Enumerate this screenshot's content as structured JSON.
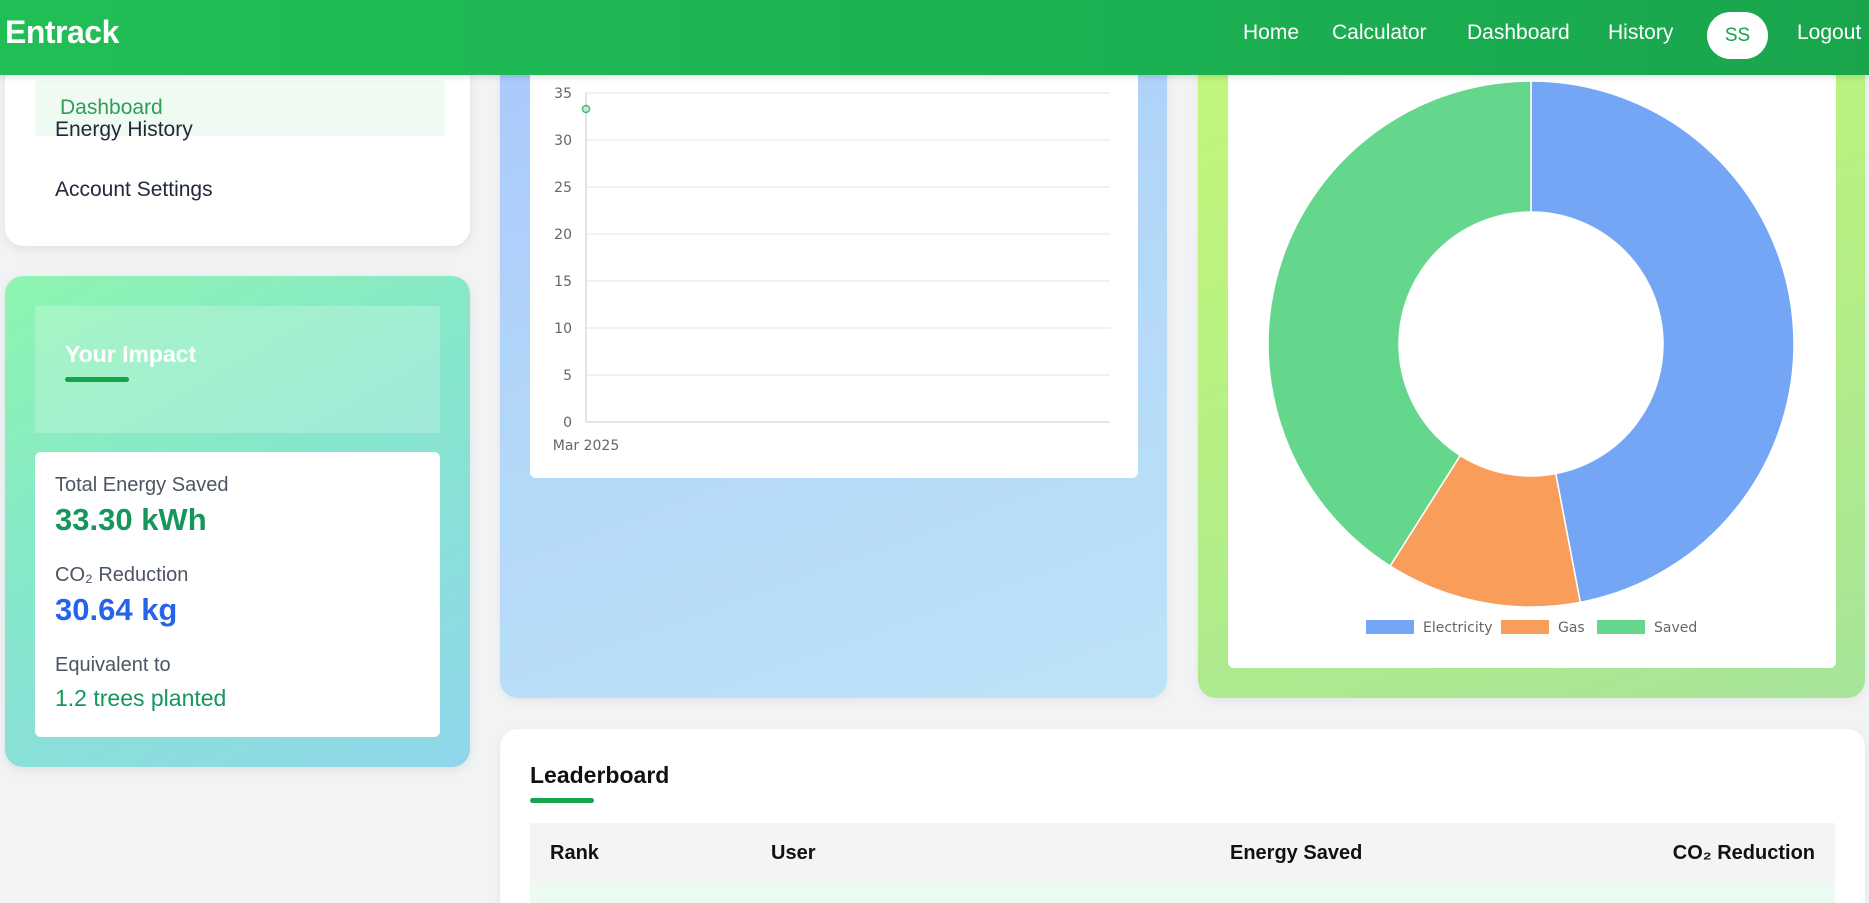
{
  "navbar": {
    "brand": "Entrack",
    "links": [
      "Home",
      "Calculator",
      "Dashboard",
      "History"
    ],
    "avatar_initials": "SS",
    "logout_label": "Logout"
  },
  "sidebar": {
    "items": [
      "Dashboard",
      "Energy History",
      "Account Settings"
    ],
    "active_item": "Dashboard"
  },
  "impact": {
    "title": "Your Impact",
    "energy_label": "Total Energy Saved",
    "energy_value": "33.30 kWh",
    "co2_label": "CO₂ Reduction",
    "co2_value": "30.64 kg",
    "equiv_label": "Equivalent to",
    "equiv_value": "1.2 trees planted"
  },
  "colors": {
    "brand_green": "#20bf55",
    "energy_value": "#15965a",
    "co2_value": "#2563eb",
    "electricity": "#74a6f5",
    "gas": "#f99e5a",
    "saved": "#65d78c"
  },
  "chart_data": [
    {
      "type": "line",
      "x": [
        "Mar 2025"
      ],
      "series": [
        {
          "values": [
            33.3
          ]
        }
      ],
      "ylim": [
        0,
        35
      ],
      "yticks": [
        0,
        5,
        10,
        15,
        20,
        25,
        30,
        35
      ],
      "grid": true
    },
    {
      "type": "pie",
      "variant": "doughnut",
      "categories": [
        "Electricity",
        "Gas",
        "Saved"
      ],
      "values": [
        47,
        12,
        41
      ],
      "legend": "bottom"
    }
  ],
  "leaderboard": {
    "title": "Leaderboard",
    "columns": [
      "Rank",
      "User",
      "Energy Saved",
      "CO₂ Reduction"
    ]
  }
}
